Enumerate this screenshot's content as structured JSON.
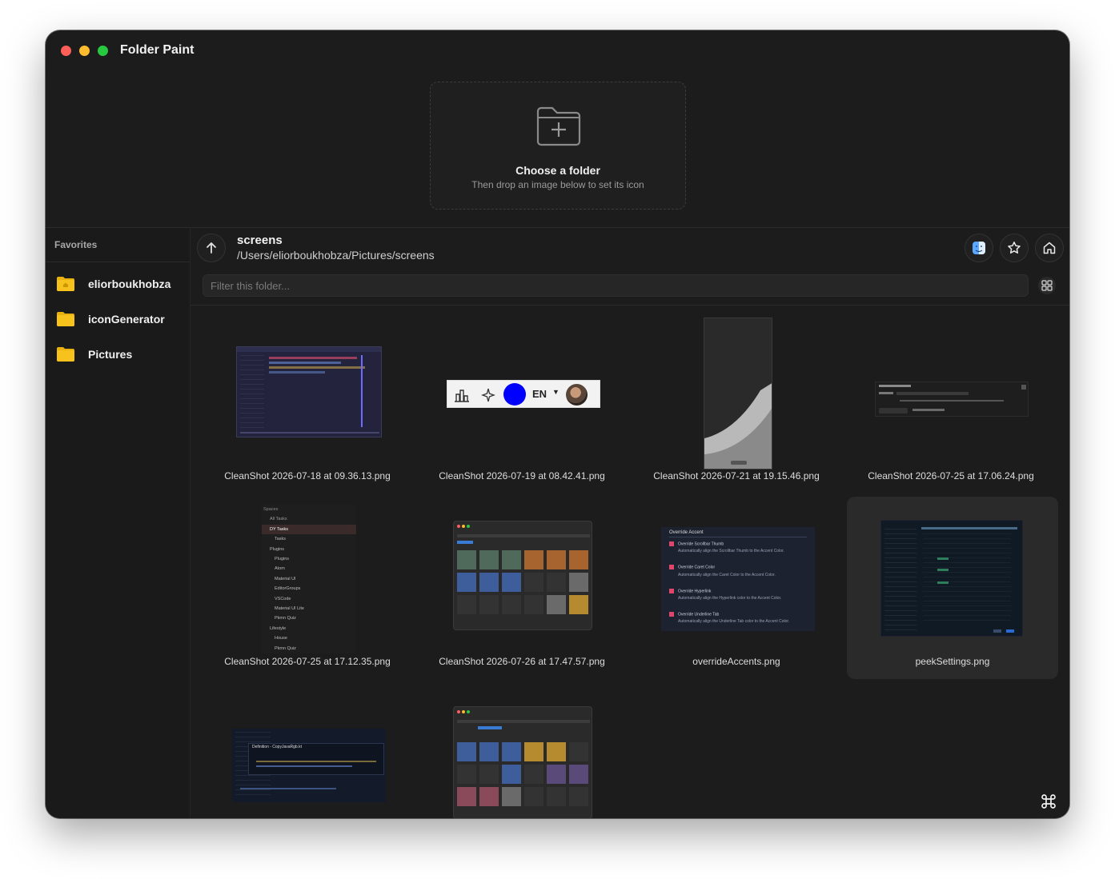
{
  "window": {
    "title": "Folder Paint"
  },
  "dropzone": {
    "title": "Choose a folder",
    "subtitle": "Then drop an image below to set its icon",
    "icon": "folder-plus-icon"
  },
  "sidebar": {
    "title": "Favorites",
    "items": [
      {
        "label": "eliorboukhobza",
        "icon": "home-folder-icon"
      },
      {
        "label": "iconGenerator",
        "icon": "folder-icon"
      },
      {
        "label": "Pictures",
        "icon": "folder-icon"
      }
    ]
  },
  "header": {
    "folder_name": "screens",
    "path": "/Users/eliorboukhobza/Pictures/screens"
  },
  "filter": {
    "placeholder": "Filter this folder...",
    "value": ""
  },
  "files": [
    {
      "name": "CleanShot 2026-07-18 at 09.36.13.png"
    },
    {
      "name": "CleanShot 2026-07-19 at 08.42.41.png"
    },
    {
      "name": "CleanShot 2026-07-21 at 19.15.46.png"
    },
    {
      "name": "CleanShot 2026-07-25 at 17.06.24.png"
    },
    {
      "name": "CleanShot 2026-07-25 at 17.12.35.png"
    },
    {
      "name": "CleanShot 2026-07-26 at 17.47.57.png"
    },
    {
      "name": "overrideAccents.png"
    },
    {
      "name": "peekSettings.png",
      "selected": true
    },
    {
      "name": ""
    },
    {
      "name": ""
    }
  ],
  "thumbnails": {
    "toolbar_lang": "EN",
    "override_accent": {
      "heading": "Override Accent",
      "items": [
        {
          "label": "Override Scrollbar Thumb",
          "desc": "Automatically align the Scrollbar Thumb to the Accent Color."
        },
        {
          "label": "Override Caret Color",
          "desc": "Automatically align the Caret Color to the Accent Color."
        },
        {
          "label": "Override Hyperlink",
          "desc": "Automatically align the Hyperlink color to the Accent Color."
        },
        {
          "label": "Override Underline Tab",
          "desc": "Automatically align the Underline Tab color to the Accent Color."
        }
      ]
    },
    "spaces_list": [
      "Spaces",
      "All Tasks",
      "DY Tasks",
      "Tasks",
      "Plugins",
      "Plugins",
      "Atom",
      "Material UI",
      "EditorGroups",
      "VSCode",
      "Material UI Lite",
      "Pkmn Quiz",
      "Lifestyle",
      "House",
      "Pkmn Quiz"
    ],
    "definition_title": "Definition - CopyJavaRgb.kt"
  },
  "colors": {
    "window_bg": "#1c1c1c",
    "folder_yellow": "#f7c21b",
    "selected_tile": "#2a2a2a",
    "accent_blue": "#0000ff"
  }
}
